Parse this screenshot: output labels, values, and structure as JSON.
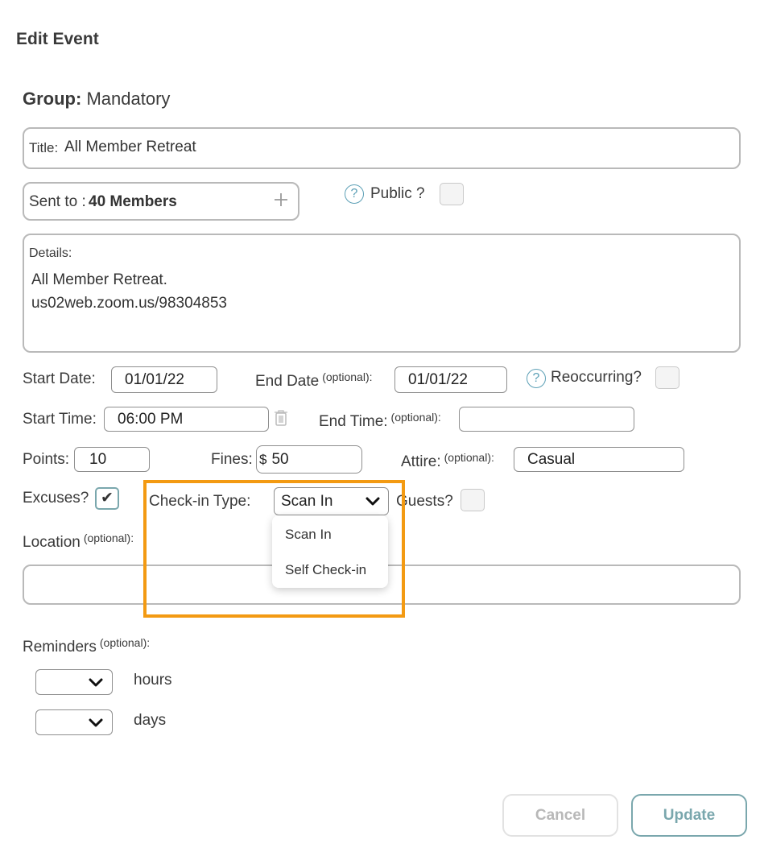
{
  "header": {
    "title": "Edit Event"
  },
  "group": {
    "label": "Group:",
    "value": "Mandatory"
  },
  "title_field": {
    "label": "Title:",
    "value": "All Member Retreat"
  },
  "sent_to": {
    "label": "Sent to :",
    "value": "40 Members",
    "add_icon": "plus-icon"
  },
  "public": {
    "help_icon": "question-circle-icon",
    "help_glyph": "?",
    "label": "Public ?",
    "checked": false
  },
  "details": {
    "label": "Details:",
    "line1": "All Member Retreat.",
    "line2": "us02web.zoom.us/98304853"
  },
  "start_date": {
    "label": "Start Date:",
    "value": "01/01/22"
  },
  "end_date": {
    "label": "End Date",
    "optional": "(optional):",
    "value": "01/01/22"
  },
  "reoccurring": {
    "help_glyph": "?",
    "label": "Reoccurring?",
    "checked": false
  },
  "start_time": {
    "label": "Start Time:",
    "value": "06:00 PM",
    "icon": "trash-icon"
  },
  "end_time": {
    "label": "End Time:",
    "optional": "(optional):",
    "value": ""
  },
  "points": {
    "label": "Points:",
    "value": "10"
  },
  "fines": {
    "label": "Fines:",
    "currency": "$",
    "value": "50"
  },
  "attire": {
    "label": "Attire:",
    "optional": "(optional):",
    "value": "Casual"
  },
  "excuses": {
    "label": "Excuses?",
    "checked": true,
    "check_glyph": "✔"
  },
  "checkin": {
    "label": "Check-in Type:",
    "selected": "Scan In",
    "options": [
      "Scan In",
      "Self Check-in"
    ],
    "highlight_color": "#f39a12"
  },
  "guests": {
    "label": "Guests?",
    "checked": false
  },
  "location": {
    "label": "Location",
    "optional": "(optional):",
    "value": ""
  },
  "reminders": {
    "label": "Reminders",
    "optional": "(optional):",
    "hours_label": "hours",
    "days_label": "days"
  },
  "footer": {
    "cancel_label": "Cancel",
    "update_label": "Update",
    "accent": "#7aa7ad"
  }
}
